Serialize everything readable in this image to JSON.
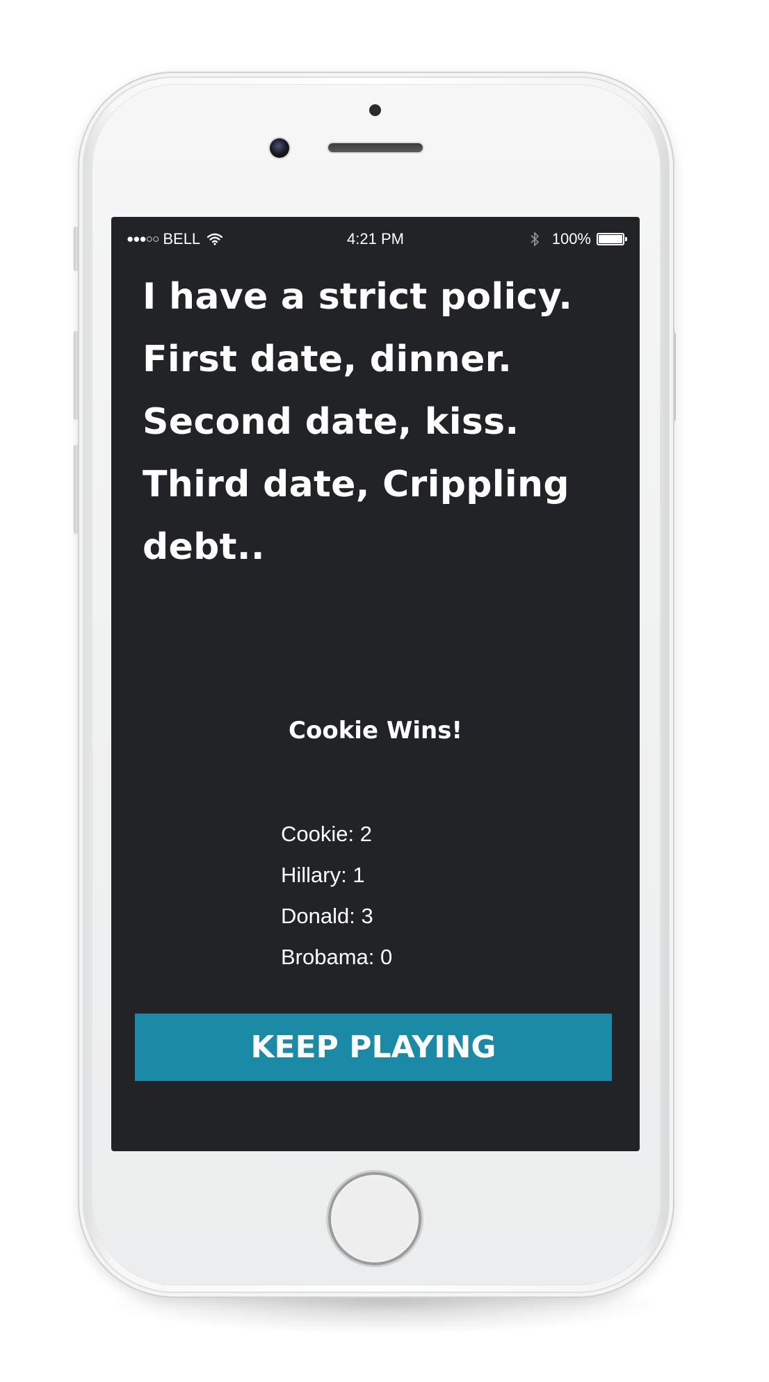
{
  "status_bar": {
    "signal": "●●●○○",
    "carrier": "BELL",
    "time": "4:21 PM",
    "battery_percent": "100%",
    "battery_level": 1.0,
    "icons": [
      "wifi-icon",
      "bluetooth-icon",
      "battery-icon"
    ]
  },
  "game": {
    "joke": "I have a strict policy. First date, dinner. Second date, kiss. Third date, Crippling debt..",
    "winner": "Cookie Wins!",
    "scores": [
      {
        "label": "Cookie: 2"
      },
      {
        "label": "Hillary: 1"
      },
      {
        "label": "Donald: 3"
      },
      {
        "label": "Brobama: 0"
      }
    ],
    "keep_playing_label": "KEEP PLAYING"
  },
  "colors": {
    "screen_background": "#222326",
    "button_background": "#1a8aa6",
    "text": "#ffffff"
  }
}
